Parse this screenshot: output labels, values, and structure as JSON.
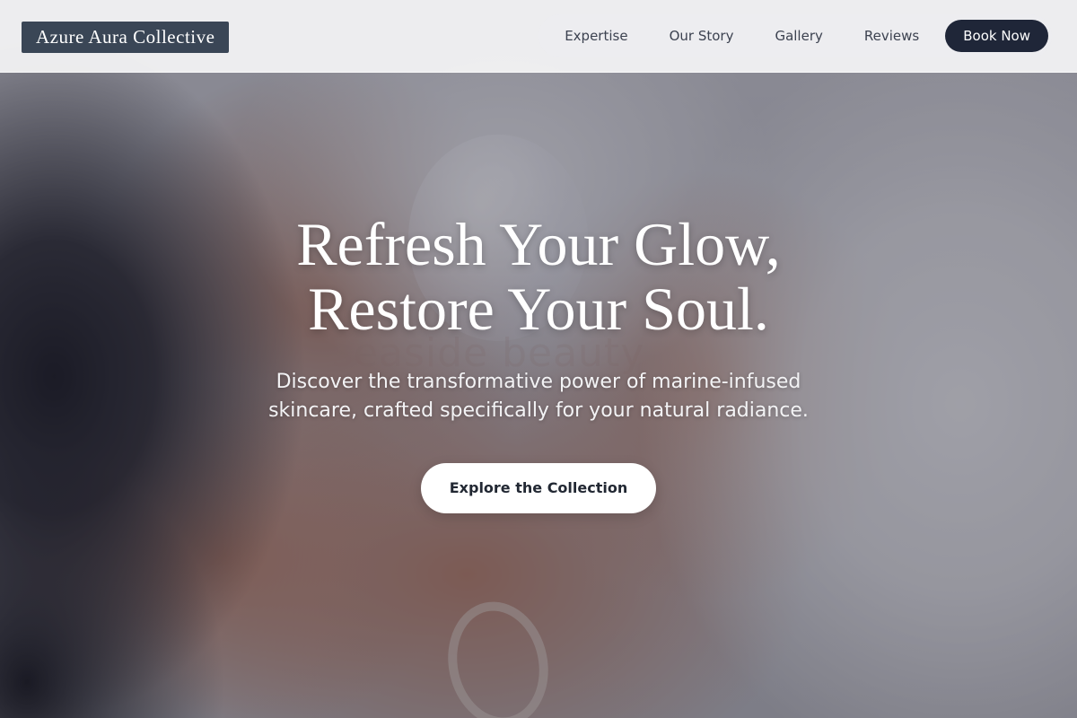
{
  "brand": {
    "name": "Azure Aura Collective"
  },
  "nav": {
    "links": [
      "Expertise",
      "Our Story",
      "Gallery",
      "Reviews"
    ],
    "cta": "Book Now"
  },
  "hero": {
    "headline_line1": "Refresh Your Glow,",
    "headline_line2": "Restore Your Soul.",
    "subhead_line1": "Discover the transformative power of marine-infused",
    "subhead_line2": "skincare, crafted specifically for your natural radiance.",
    "cta": "Explore the Collection",
    "watermark": "seaside beauty"
  },
  "colors": {
    "brand_bg": "#3a4656",
    "cta_dark": "#1f2638",
    "cta_light": "#ffffff"
  }
}
